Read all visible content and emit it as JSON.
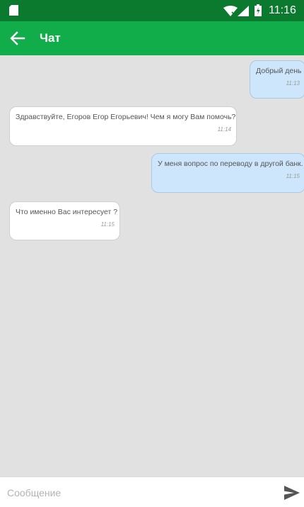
{
  "status_bar": {
    "time": "11:16"
  },
  "app_bar": {
    "title": "Чат"
  },
  "messages": [
    {
      "direction": "outgoing",
      "text": "Добрый день",
      "time": "11:13"
    },
    {
      "direction": "incoming",
      "text": "Здравствуйте, Егоров Егор Егорьевич! Чем я могу Вам помочь?",
      "time": "11:14"
    },
    {
      "direction": "outgoing",
      "text": "У меня вопрос по переводу в другой банк.",
      "time": "11:15"
    },
    {
      "direction": "incoming",
      "text": "Что именно Вас интересует ?",
      "time": "11:15"
    }
  ],
  "input": {
    "placeholder": "Сообщение",
    "value": ""
  },
  "colors": {
    "status_bar": "#0c7a2e",
    "app_bar": "#10ad4a",
    "chat_background": "#e1e1e1",
    "outgoing_bubble": "#cde6fb",
    "incoming_bubble": "#ffffff"
  },
  "icons": {
    "status": [
      "sd-card-icon",
      "wifi-icon",
      "signal-icon",
      "battery-icon"
    ],
    "app_bar": "arrow-back-icon",
    "input": "send-icon"
  }
}
